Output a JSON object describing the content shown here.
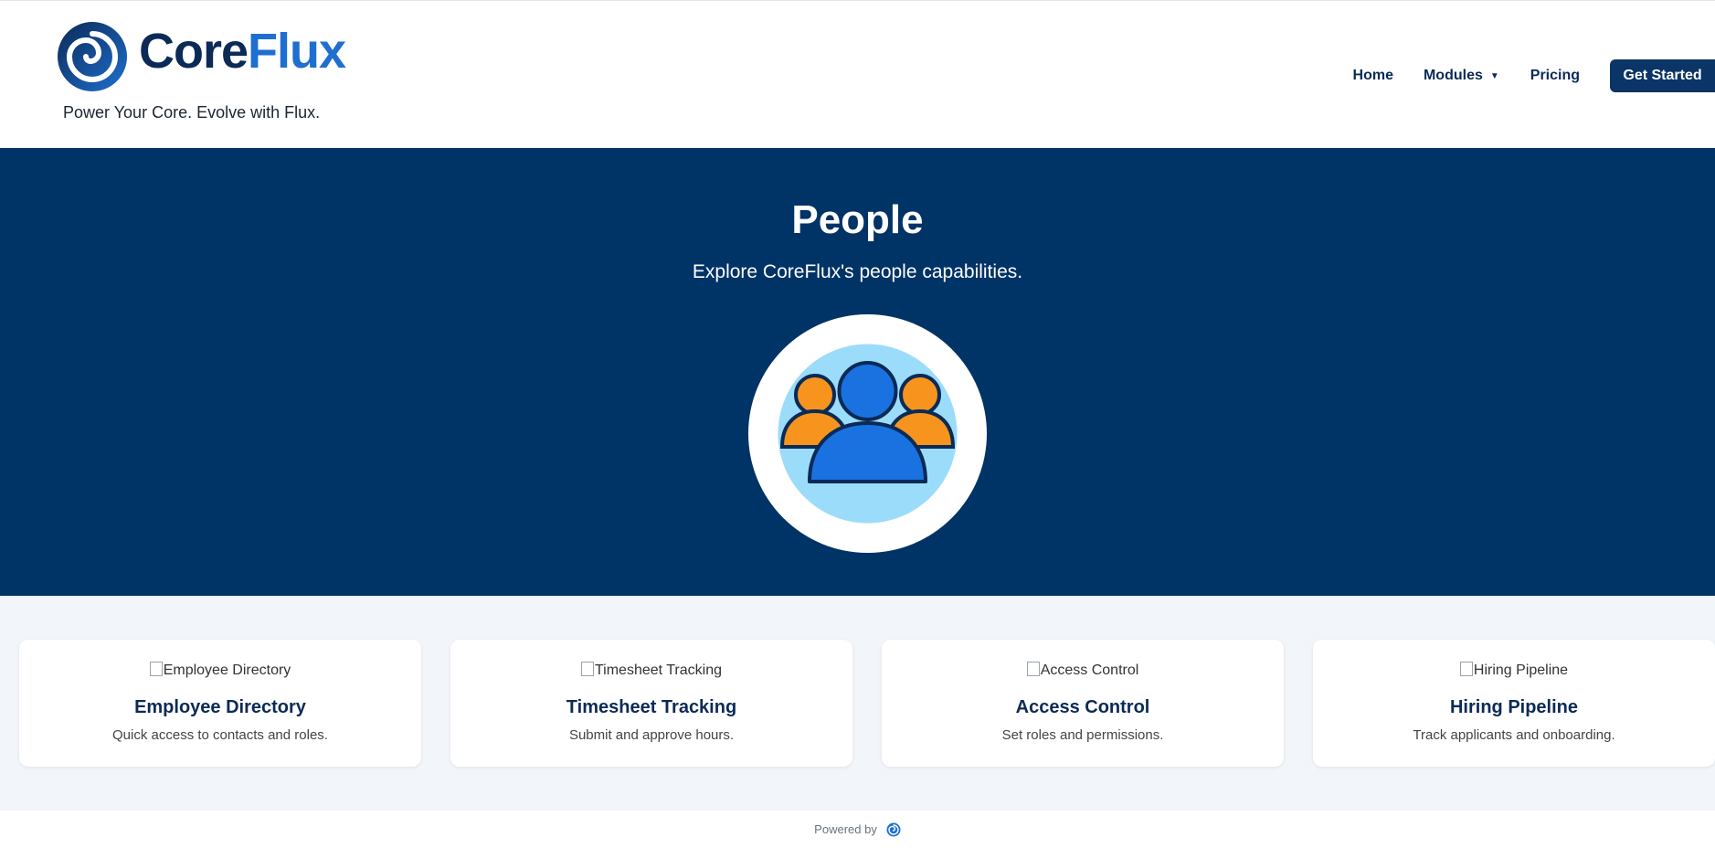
{
  "brand": {
    "name_part1": "Core",
    "name_part2": "Flux",
    "tagline": "Power Your Core. Evolve with Flux."
  },
  "nav": {
    "home": "Home",
    "modules": "Modules",
    "pricing": "Pricing",
    "cta": "Get Started"
  },
  "hero": {
    "title": "People",
    "subtitle": "Explore CoreFlux's people capabilities."
  },
  "cards": [
    {
      "img_alt": "Employee Directory",
      "title": "Employee Directory",
      "desc": "Quick access to contacts and roles."
    },
    {
      "img_alt": "Timesheet Tracking",
      "title": "Timesheet Tracking",
      "desc": "Submit and approve hours."
    },
    {
      "img_alt": "Access Control",
      "title": "Access Control",
      "desc": "Set roles and permissions."
    },
    {
      "img_alt": "Hiring Pipeline",
      "title": "Hiring Pipeline",
      "desc": "Track applicants and onboarding."
    }
  ],
  "footer": {
    "powered_by": "Powered by"
  },
  "icons": {
    "logo": "swirl-logo-icon",
    "modules_caret": "caret-down-icon",
    "hero": "people-group-icon",
    "footer_logo": "swirl-logo-icon"
  },
  "colors": {
    "navy": "#003366",
    "brand_dark": "#0b2a56",
    "brand_blue": "#1f6fd0",
    "orange": "#f7941d",
    "light_blue": "#9cdcfb"
  }
}
